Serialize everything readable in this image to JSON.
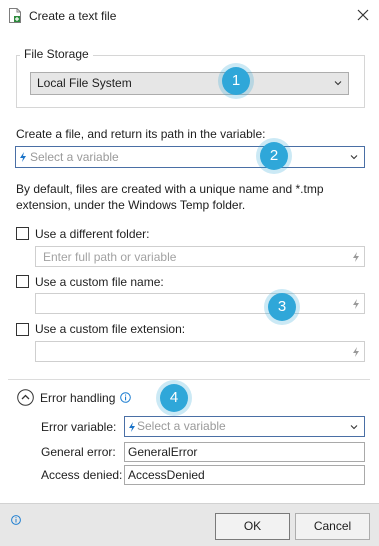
{
  "window": {
    "title": "Create a text file"
  },
  "file_storage": {
    "legend": "File Storage",
    "selected": "Local File System"
  },
  "variable": {
    "label": "Create a file, and return its path in the variable:",
    "placeholder": "Select a variable"
  },
  "description": {
    "line1": "By default, files are created with a unique name and *.tmp",
    "line2": "extension, under the Windows Temp folder."
  },
  "options": {
    "folder_label": "Use a different folder:",
    "folder_placeholder": "Enter full path or variable",
    "name_label": "Use a custom file name:",
    "ext_label": "Use a custom file extension:"
  },
  "error_handling": {
    "label": "Error handling",
    "variable_label": "Error variable:",
    "variable_placeholder": "Select a variable",
    "general_label": "General error:",
    "general_value": "GeneralError",
    "denied_label": "Access denied:",
    "denied_value": "AccessDenied"
  },
  "badges": [
    "1",
    "2",
    "3",
    "4"
  ],
  "footer": {
    "ok": "OK",
    "cancel": "Cancel"
  },
  "colors": {
    "accent": "#2fa7d9",
    "link_blue": "#1a73c8",
    "info_blue": "#1f7fd1"
  }
}
